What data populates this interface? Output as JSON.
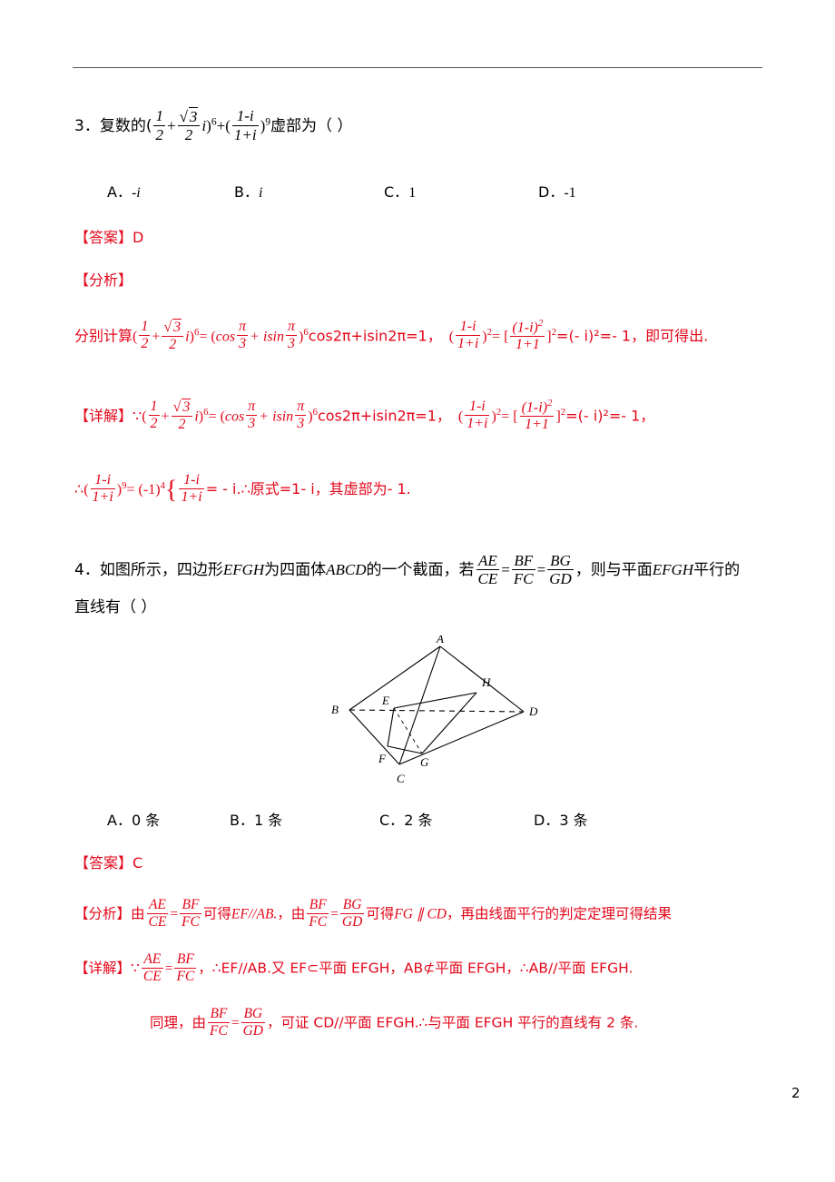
{
  "page": {
    "number": "2"
  },
  "q3": {
    "label": "3．",
    "stem_prefix": "复数的(",
    "frac1_num": "1",
    "frac1_den": "2",
    "plus": "+",
    "sqrt_radicand": "3",
    "frac2_den": "2",
    "i": "i",
    "close_pow6": ")",
    "pow6": "6",
    "mid_plus": "+",
    "open2": "(",
    "frac3_num": "1-i",
    "frac3_den": "1+i",
    "close2": ")",
    "pow9": "9",
    "stem_suffix": "虚部为（     ）",
    "options": [
      {
        "key": "A．",
        "text": "-i"
      },
      {
        "key": "B．",
        "text": "i"
      },
      {
        "key": "C．",
        "text": "1"
      },
      {
        "key": "D．",
        "text": "-1"
      }
    ],
    "answer_label": "【答案】",
    "answer_value": "D",
    "analysis_label": "【分析】",
    "analysis_text_start": "分别计算",
    "analysis_eq_open": "(",
    "analysis_eq_i": "i",
    "analysis_eq_close": ")",
    "analysis_eq_pow": "6",
    "analysis_equals": "= (",
    "analysis_cos": "cos",
    "analysis_pi_num": "π",
    "analysis_pi_den": "3",
    "analysis_plus_isin": "+ isin",
    "analysis_close2": ")",
    "analysis_result": "cos2π+isin2π=1，",
    "analysis_second_open": "(",
    "analysis_second_close": ")",
    "analysis_second_pow": "2",
    "analysis_bracket_open": "= [",
    "analysis_bracket_num": "(1-i)",
    "analysis_bracket_numpow": "2",
    "analysis_bracket_den": "1+1",
    "analysis_bracket_close": "]",
    "analysis_bracket_pow": "2",
    "analysis_tail": "=(- i)²=- 1，即可得出.",
    "detail_label": "【详解】",
    "detail_therefore": "∵",
    "detail_tail": "=(- i)²=- 1，",
    "detail2_because": "∴",
    "detail2_num": "1-i",
    "detail2_den": "1+i",
    "detail2_pow": "9",
    "detail2_eq": "= (-1)",
    "detail2_eq_pow": "4",
    "detail2_brace_num": "1-i",
    "detail2_brace_den": "1+i",
    "detail2_tail": "= - i.∴原式=1- i，其虚部为- 1."
  },
  "q4": {
    "label": "4．",
    "line1_a": "如图所示，四边形",
    "line1_efgh": "EFGH",
    "line1_b": "为四面体",
    "line1_abcd": "ABCD",
    "line1_c": "的一个截面，若",
    "f1_num": "AE",
    "f1_den": "CE",
    "eq1": "=",
    "f2_num": "BF",
    "f2_den": "FC",
    "eq2": "=",
    "f3_num": "BG",
    "f3_den": "GD",
    "line1_d": "，则与平面",
    "line1_efgh2": "EFGH",
    "line1_e": "平行的",
    "line2": "直线有（     ）",
    "figure_labels": [
      "A",
      "H",
      "E",
      "B",
      "D",
      "G",
      "F",
      "C"
    ],
    "options": [
      {
        "key": "A．",
        "text": "0 条"
      },
      {
        "key": "B．",
        "text": "1 条"
      },
      {
        "key": "C．",
        "text": "2 条"
      },
      {
        "key": "D．",
        "text": "3 条"
      }
    ],
    "answer_label": "【答案】",
    "answer_value": "C",
    "analysis_label": "【分析】",
    "analysis_by1": "由",
    "a_f1_num": "AE",
    "a_f1_den": "CE",
    "a_eq1": "=",
    "a_f2_num": "BF",
    "a_f2_den": "FC",
    "analysis_mid1": "可得",
    "analysis_ef": "EF//AB.",
    "analysis_by2": "，由",
    "a_f3_num": "BF",
    "a_f3_den": "FC",
    "a_eq2": "=",
    "a_f4_num": "BG",
    "a_f4_den": "GD",
    "analysis_mid2": "可得",
    "analysis_fg": "FG ∥ CD",
    "analysis_tail": "，再由线面平行的判定定理可得结果",
    "detail_label": "【详解】",
    "detail_because": "∵",
    "d_f1_num": "AE",
    "d_f1_den": "CE",
    "d_eq1": "=",
    "d_f2_num": "BF",
    "d_f2_den": "FC",
    "detail_tail": "，∴EF//AB.又 EF⊂平面 EFGH，AB⊄平面 EFGH，∴AB//平面 EFGH.",
    "detail2_head": "同理，由",
    "d_f3_num": "BF",
    "d_f3_den": "FC",
    "d_eq2": "=",
    "d_f4_num": "BG",
    "d_f4_den": "GD",
    "detail2_tail": "，可证 CD//平面 EFGH.∴与平面 EFGH 平行的直线有 2 条."
  },
  "colors": {
    "red": "#e3071a",
    "text": "#000000",
    "rule": "#555555"
  }
}
